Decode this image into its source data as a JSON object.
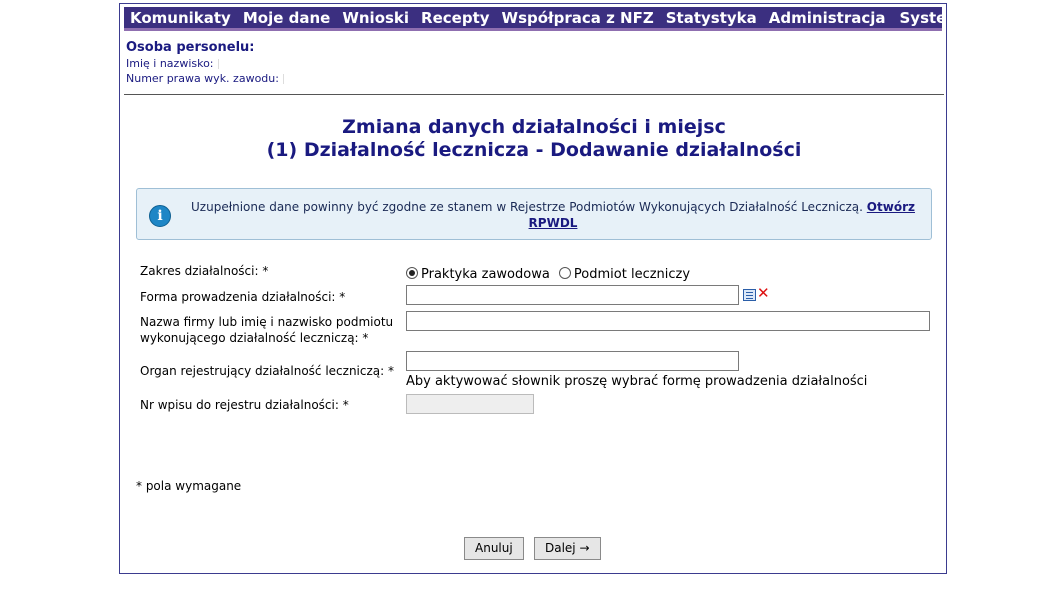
{
  "nav": {
    "items": [
      "Komunikaty",
      "Moje dane",
      "Wnioski",
      "Recepty",
      "Współpraca z NFZ",
      "Statystyka",
      "Administracja"
    ],
    "system": "System"
  },
  "personnel": {
    "title": "Osoba personelu:",
    "name_label": "Imię i nazwisko:",
    "license_label": "Numer prawa wyk. zawodu:"
  },
  "page": {
    "title_line1": "Zmiana danych działalności i miejsc",
    "title_line2": "(1) Działalność lecznicza - Dodawanie działalności"
  },
  "info": {
    "text": "Uzupełnione dane powinny być zgodne ze stanem w Rejestrze Podmiotów Wykonujących Działalność Leczniczą.",
    "link": "Otwórz RPWDL",
    "icon": "info-icon"
  },
  "form": {
    "scope_label": "Zakres działalności: *",
    "scope_options": [
      "Praktyka zawodowa",
      "Podmiot leczniczy"
    ],
    "scope_selected": "Praktyka zawodowa",
    "form_label": "Forma prowadzenia działalności: *",
    "form_value": "",
    "company_label_line1": "Nazwa firmy lub imię i nazwisko podmiotu",
    "company_label_line2": "wykonującego działalność leczniczą: *",
    "company_value": "",
    "organ_label": "Organ rejestrujący działalność leczniczą: *",
    "organ_value": "",
    "organ_hint": "Aby aktywować słownik proszę wybrać formę prowadzenia działalności",
    "registry_label": "Nr wpisu do rejestru działalności: *",
    "registry_value": "",
    "required_note": "* pola wymagane"
  },
  "buttons": {
    "cancel": "Anuluj",
    "next": "Dalej →"
  },
  "colors": {
    "nav_bg": "#3b2f80",
    "title": "#1a1a80",
    "info_bg": "#e7f1f8",
    "info_icon": "#1e86c6"
  }
}
